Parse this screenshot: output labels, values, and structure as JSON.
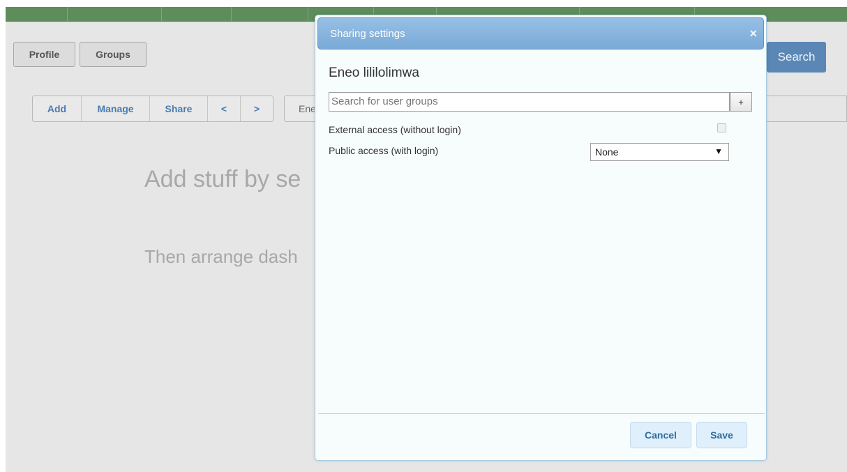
{
  "background": {
    "nav": {
      "profile_label": "Profile",
      "groups_label": "Groups",
      "search_label": "Search"
    },
    "toolbar": {
      "items": [
        "Add",
        "Manage",
        "Share",
        "<",
        ">"
      ],
      "dashboard_label": "Ene"
    },
    "hint_primary": "Add stuff by se",
    "hint_secondary": "Then arrange dash"
  },
  "dialog": {
    "title": "Sharing settings",
    "close_glyph": "×",
    "group_name": "Eneo lililolimwa",
    "search": {
      "placeholder": "Search for user groups",
      "add_label": "+"
    },
    "external_access": {
      "label": "External access (without login)",
      "checked": false
    },
    "public_access": {
      "label": "Public access (with login)",
      "value": "None"
    },
    "cancel_label": "Cancel",
    "save_label": "Save"
  },
  "colors": {
    "topbar": "#5d8d5b",
    "title_bar": "#7aaad7",
    "primary_button": "#5a87b5",
    "link_text": "#4a7bb2"
  },
  "icons": {
    "close": "close-icon",
    "dropdown": "caret-down-icon"
  }
}
